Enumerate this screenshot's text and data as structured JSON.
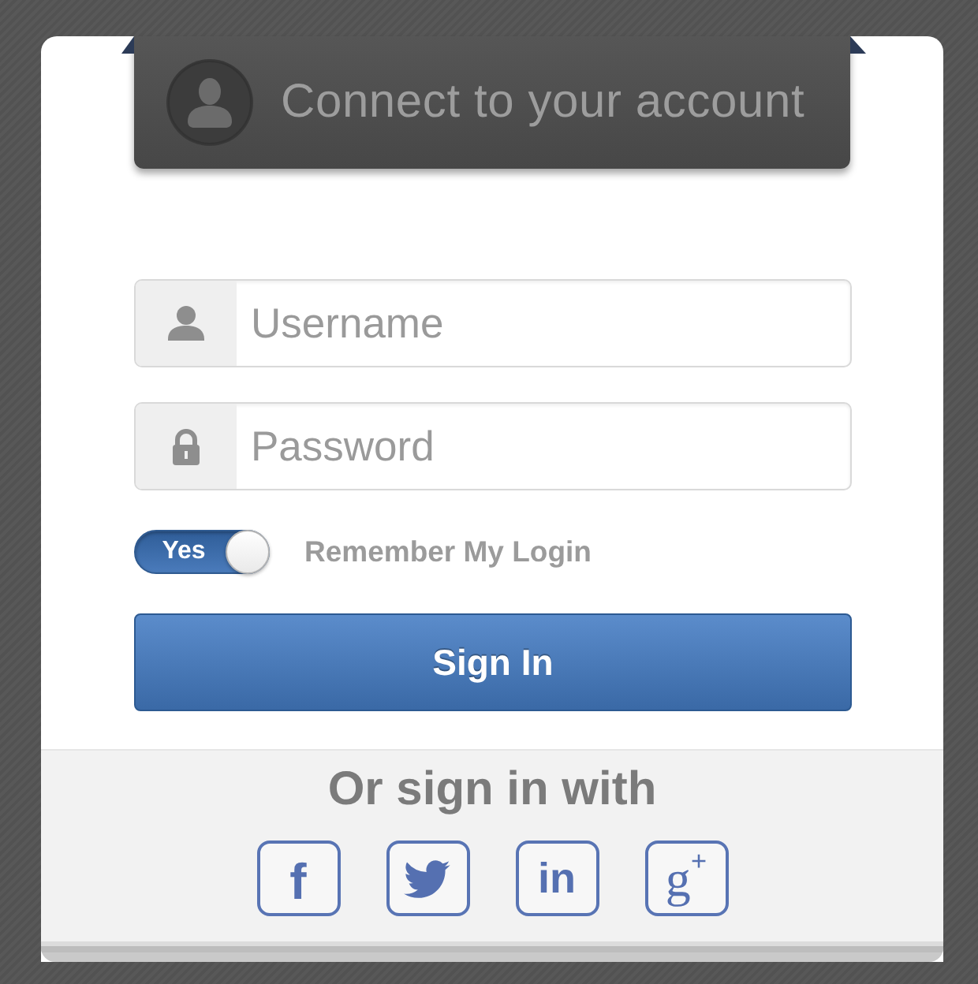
{
  "header": {
    "title": "Connect to your account"
  },
  "fields": [
    {
      "kind": "username",
      "placeholder": "Username"
    },
    {
      "kind": "password",
      "placeholder": "Password"
    }
  ],
  "remember": {
    "toggle_text": "Yes",
    "on": true,
    "label": "Remember My Login"
  },
  "sign_in_button": {
    "label": "Sign In"
  },
  "social": {
    "heading": "Or sign in with",
    "buttons": [
      {
        "kind": "facebook",
        "glyph": "f"
      },
      {
        "kind": "twitter"
      },
      {
        "kind": "linkedin",
        "glyph": "in"
      },
      {
        "kind": "google_plus",
        "glyph": "g$^{+}$"
      }
    ]
  }
}
